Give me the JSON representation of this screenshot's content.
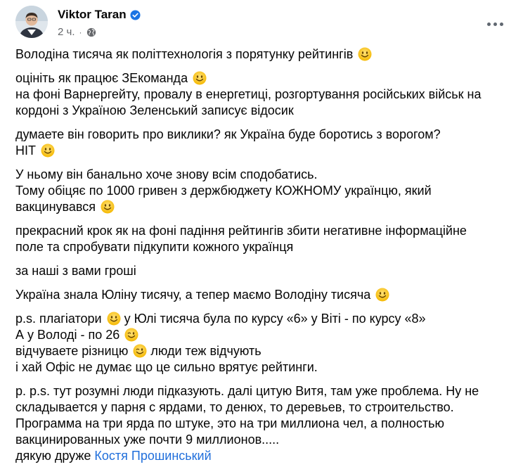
{
  "post": {
    "author": {
      "name": "Viktor Taran",
      "verified_icon": "verified-badge-icon"
    },
    "meta": {
      "time": "2 ч.",
      "separator": "·",
      "audience_icon": "globe-icon"
    },
    "more_icon": "more-options-icon",
    "body": {
      "p1": {
        "l1": "Володіна тисяча як політтехнологія з порятунку рейтингів"
      },
      "p2": {
        "l1": "оцініть як працює ЗЕкоманда",
        "l2": "на фоні Варнергейту, провалу в енергетиці, розгортування російських військ на",
        "l3": "кордоні з Україною Зеленський записує відосик"
      },
      "p3": {
        "l1": "думаете він говорить про виклики? як Україна буде боротись з ворогом?",
        "l2": "НІТ"
      },
      "p4": {
        "l1": "У ньому він банально хоче знову всім сподобатись.",
        "l2": "Тому обіцяє по 1000 гривен з держбюджету КОЖНОМУ українцю, який",
        "l3": "вакцинувався"
      },
      "p5": {
        "l1": "прекрасний крок як на фоні падіння рейтингів збити негативне інформаційне",
        "l2": "поле та спробувати підкупити кожного українця"
      },
      "p6": {
        "l1": "за наші з вами гроші"
      },
      "p7": {
        "l1": "Україна знала Юліну тисячу, а тепер маємо Володіну тисяча"
      },
      "p8": {
        "l1a": "p.s. плагіатори",
        "l1b": "у Юлі тисяча була по курсу «6» у Віті - по курсу «8»",
        "l2": "А у Володі - по 26",
        "l3a": "відчуваете різницю",
        "l3b": "люди теж відчують",
        "l4": "і хай Офіс не думає що це сильно врятує рейтинги."
      },
      "p9": {
        "l1": "p. p.s. тут розумні люди підказують. далі цитую Витя, там уже проблема. Ну не",
        "l2": "складывается у парня с ярдами, то денюх, то деревьев, то строительство.",
        "l3": "Программа на три ярда по штуке, это на три миллиона чел, а полностью",
        "l4": "вакцинированных уже почти 9 миллионов.....",
        "l5_prefix": "дякую друже",
        "l5_mention": "Костя Прошинський"
      }
    },
    "emoji_names": {
      "smile": "slightly-smiling-face-icon",
      "wink": "winking-face-icon"
    }
  }
}
